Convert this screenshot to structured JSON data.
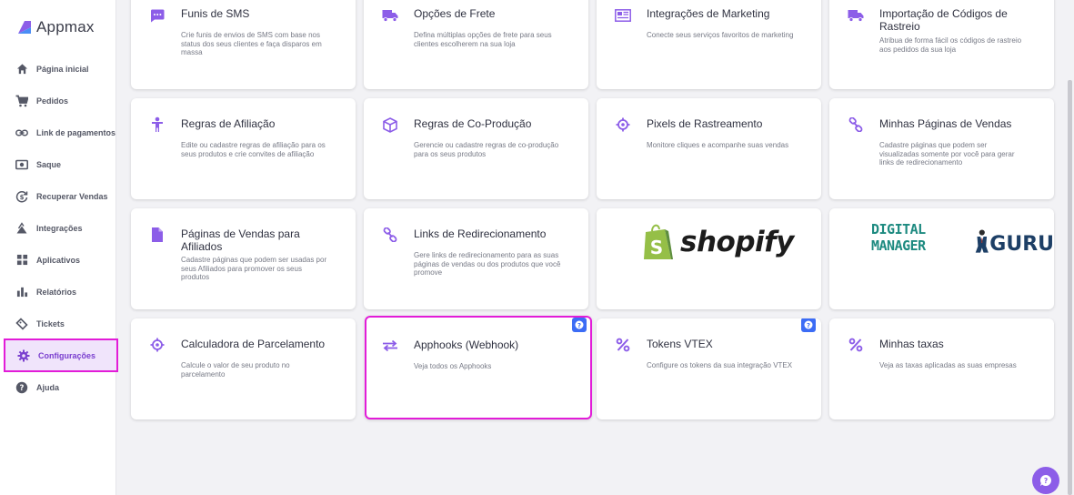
{
  "app": {
    "name": "Appmax"
  },
  "sidebar": {
    "items": [
      {
        "label": "Página inicial",
        "icon": "home-icon"
      },
      {
        "label": "Pedidos",
        "icon": "cart-icon"
      },
      {
        "label": "Link de pagamentos",
        "icon": "link-icon"
      },
      {
        "label": "Saque",
        "icon": "money-icon"
      },
      {
        "label": "Recuperar Vendas",
        "icon": "recover-icon"
      },
      {
        "label": "Integrações",
        "icon": "integrations-icon"
      },
      {
        "label": "Aplicativos",
        "icon": "apps-icon"
      },
      {
        "label": "Relatórios",
        "icon": "reports-icon"
      },
      {
        "label": "Tickets",
        "icon": "ticket-icon"
      },
      {
        "label": "Configurações",
        "icon": "gear-icon",
        "active": true
      },
      {
        "label": "Ajuda",
        "icon": "help-icon"
      }
    ]
  },
  "cards": {
    "sms": {
      "title": "Funis de SMS",
      "desc": "Crie funis de envios de SMS com base nos status dos seus clientes e faça disparos em massa",
      "icon": "sms-icon"
    },
    "frete": {
      "title": "Opções de Frete",
      "desc": "Defina múltiplas opções de frete para seus clientes escolherem na sua loja",
      "icon": "truck-icon"
    },
    "marketing": {
      "title": "Integrações de Marketing",
      "desc": "Conecte seus serviços favoritos de marketing",
      "icon": "newspaper-icon"
    },
    "rastreio": {
      "title": "Importação de Códigos de Rastreio",
      "desc": "Atribua de forma fácil os códigos de rastreio aos pedidos da sua loja",
      "icon": "truck-icon"
    },
    "afiliacao": {
      "title": "Regras de Afiliação",
      "desc": "Edite ou cadastre regras de afiliação para os seus produtos e crie convites de afiliação",
      "icon": "person-icon"
    },
    "coproducao": {
      "title": "Regras de Co-Produção",
      "desc": "Gerencie ou cadastre regras de co-produção para os seus produtos",
      "icon": "box-icon"
    },
    "pixels": {
      "title": "Pixels de Rastreamento",
      "desc": "Monitore cliques e acompanhe suas vendas",
      "icon": "crosshair-icon"
    },
    "paginas": {
      "title": "Minhas Páginas de Vendas",
      "desc": "Cadastre páginas que podem ser visualizadas somente por você para gerar links de redirecionamento",
      "icon": "link-icon"
    },
    "paginas_afiliados": {
      "title": "Páginas de Vendas para Afiliados",
      "desc": "Cadastre páginas que podem ser usadas por seus Afiliados para promover os seus produtos",
      "icon": "document-icon"
    },
    "links": {
      "title": "Links de Redirecionamento",
      "desc": "Gere links de redirecionamento para as suas páginas de vendas ou dos produtos que você promove",
      "icon": "link-icon"
    },
    "shopify": {
      "logo_text": "shopify"
    },
    "guru": {
      "logo_text1": "DIGITAL MANAGER",
      "logo_text2": "GURU"
    },
    "calculadora": {
      "title": "Calculadora de Parcelamento",
      "desc": "Calcule o valor de seu produto no parcelamento",
      "icon": "crosshair-icon"
    },
    "apphooks": {
      "title": "Apphooks (Webhook)",
      "desc": "Veja todos os Apphooks",
      "icon": "swap-icon"
    },
    "vtex": {
      "title": "Tokens VTEX",
      "desc": "Configure os tokens da sua integração VTEX",
      "icon": "percent-icon"
    },
    "taxas": {
      "title": "Minhas taxas",
      "desc": "Veja as taxas aplicadas as suas empresas",
      "icon": "percent-icon"
    }
  },
  "colors": {
    "accent": "#8c5de8",
    "highlight": "#e21cd8",
    "badge": "#3c6cf5"
  }
}
